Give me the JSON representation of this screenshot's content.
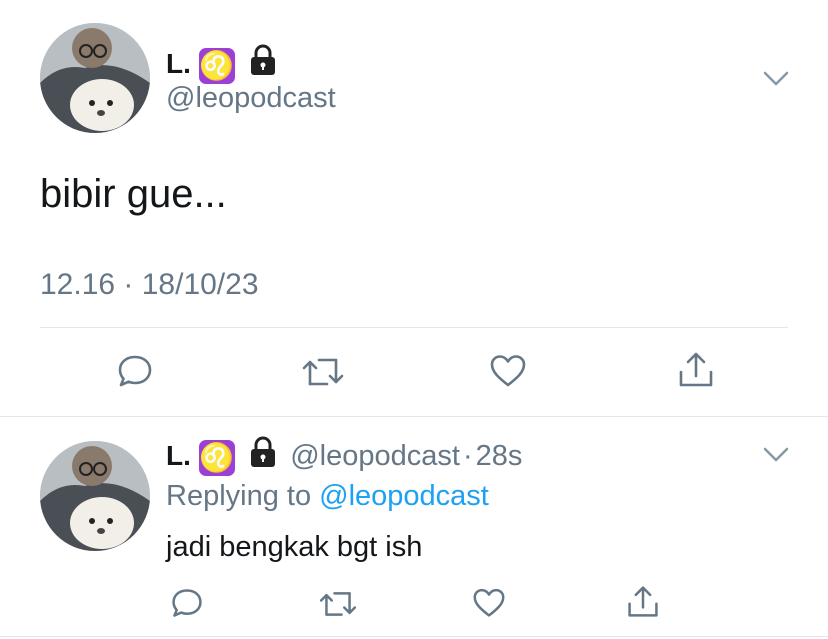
{
  "main_tweet": {
    "name": "L.",
    "handle": "@leopodcast",
    "text": "bibir gue...",
    "timestamp": "12.16 · 18/10/23"
  },
  "reply": {
    "name": "L.",
    "handle": "@leopodcast",
    "time_sep": "·",
    "time": "28s",
    "replying_prefix": "Replying to",
    "replying_to": "@leopodcast",
    "text": "jadi bengkak bgt ish"
  },
  "colors": {
    "text": "#14171a",
    "secondary": "#657786",
    "link": "#1da1f2",
    "divider": "#e1e8ed",
    "leo_badge": "#9c3fd6"
  },
  "icons": [
    "leo-zodiac-icon",
    "lock-icon",
    "chevron-down-icon",
    "reply-icon",
    "retweet-icon",
    "like-icon",
    "share-icon"
  ]
}
